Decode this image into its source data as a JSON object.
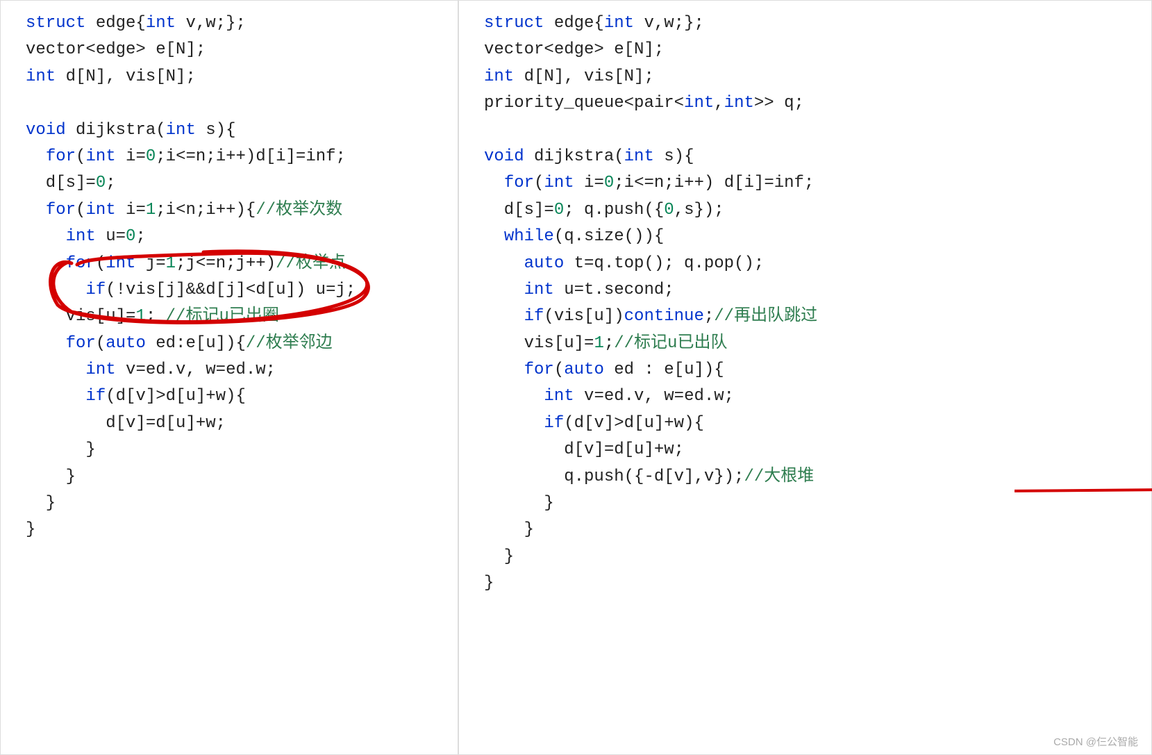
{
  "watermark": "CSDN @仨公智能",
  "left": {
    "tokens": [
      [
        [
          "kw",
          "struct"
        ],
        [
          "txt",
          " edge{"
        ],
        [
          "kw",
          "int"
        ],
        [
          "txt",
          " v,w;};"
        ]
      ],
      [
        [
          "txt",
          "vector<edge> e[N];"
        ]
      ],
      [
        [
          "kw",
          "int"
        ],
        [
          "txt",
          " d[N], vis[N];"
        ]
      ],
      [
        [
          "txt",
          ""
        ]
      ],
      [
        [
          "kw",
          "void"
        ],
        [
          "txt",
          " dijkstra("
        ],
        [
          "kw",
          "int"
        ],
        [
          "txt",
          " s){"
        ]
      ],
      [
        [
          "txt",
          "  "
        ],
        [
          "kw",
          "for"
        ],
        [
          "txt",
          "("
        ],
        [
          "kw",
          "int"
        ],
        [
          "txt",
          " i="
        ],
        [
          "num",
          "0"
        ],
        [
          "txt",
          ";i<=n;i++)d[i]=inf;"
        ]
      ],
      [
        [
          "txt",
          "  d[s]="
        ],
        [
          "num",
          "0"
        ],
        [
          "txt",
          ";"
        ]
      ],
      [
        [
          "txt",
          "  "
        ],
        [
          "kw",
          "for"
        ],
        [
          "txt",
          "("
        ],
        [
          "kw",
          "int"
        ],
        [
          "txt",
          " i="
        ],
        [
          "num",
          "1"
        ],
        [
          "txt",
          ";i<n;i++){"
        ],
        [
          "cm",
          "//枚举次数"
        ]
      ],
      [
        [
          "txt",
          "    "
        ],
        [
          "kw",
          "int"
        ],
        [
          "txt",
          " u="
        ],
        [
          "num",
          "0"
        ],
        [
          "txt",
          ";"
        ]
      ],
      [
        [
          "txt",
          "    "
        ],
        [
          "kw",
          "for"
        ],
        [
          "txt",
          "("
        ],
        [
          "kw",
          "int"
        ],
        [
          "txt",
          " j="
        ],
        [
          "num",
          "1"
        ],
        [
          "txt",
          ";j<=n;j++)"
        ],
        [
          "cm",
          "//枚举点"
        ]
      ],
      [
        [
          "txt",
          "      "
        ],
        [
          "kw",
          "if"
        ],
        [
          "txt",
          "(!vis[j]&&d[j]<d[u]) u=j;"
        ]
      ],
      [
        [
          "txt",
          "    vis[u]="
        ],
        [
          "num",
          "1"
        ],
        [
          "txt",
          "; "
        ],
        [
          "cm",
          "//标记u已出圈"
        ]
      ],
      [
        [
          "txt",
          "    "
        ],
        [
          "kw",
          "for"
        ],
        [
          "txt",
          "("
        ],
        [
          "kw",
          "auto"
        ],
        [
          "txt",
          " ed:e[u]){"
        ],
        [
          "cm",
          "//枚举邻边"
        ]
      ],
      [
        [
          "txt",
          "      "
        ],
        [
          "kw",
          "int"
        ],
        [
          "txt",
          " v=ed.v, w=ed.w;"
        ]
      ],
      [
        [
          "txt",
          "      "
        ],
        [
          "kw",
          "if"
        ],
        [
          "txt",
          "(d[v]>d[u]+w){"
        ]
      ],
      [
        [
          "txt",
          "        d[v]=d[u]+w;"
        ]
      ],
      [
        [
          "txt",
          "      }"
        ]
      ],
      [
        [
          "txt",
          "    }"
        ]
      ],
      [
        [
          "txt",
          "  }"
        ]
      ],
      [
        [
          "txt",
          "}"
        ]
      ]
    ]
  },
  "right": {
    "tokens": [
      [
        [
          "kw",
          "struct"
        ],
        [
          "txt",
          " edge{"
        ],
        [
          "kw",
          "int"
        ],
        [
          "txt",
          " v,w;};"
        ]
      ],
      [
        [
          "txt",
          "vector<edge> e[N];"
        ]
      ],
      [
        [
          "kw",
          "int"
        ],
        [
          "txt",
          " d[N], vis[N];"
        ]
      ],
      [
        [
          "txt",
          "priority_queue<pair<"
        ],
        [
          "kw",
          "int"
        ],
        [
          "txt",
          ","
        ],
        [
          "kw",
          "int"
        ],
        [
          "txt",
          ">> q;"
        ]
      ],
      [
        [
          "txt",
          ""
        ]
      ],
      [
        [
          "kw",
          "void"
        ],
        [
          "txt",
          " dijkstra("
        ],
        [
          "kw",
          "int"
        ],
        [
          "txt",
          " s){"
        ]
      ],
      [
        [
          "txt",
          "  "
        ],
        [
          "kw",
          "for"
        ],
        [
          "txt",
          "("
        ],
        [
          "kw",
          "int"
        ],
        [
          "txt",
          " i="
        ],
        [
          "num",
          "0"
        ],
        [
          "txt",
          ";i<=n;i++) d[i]=inf;"
        ]
      ],
      [
        [
          "txt",
          "  d[s]="
        ],
        [
          "num",
          "0"
        ],
        [
          "txt",
          "; q.push({"
        ],
        [
          "num",
          "0"
        ],
        [
          "txt",
          ",s});"
        ]
      ],
      [
        [
          "txt",
          "  "
        ],
        [
          "kw",
          "while"
        ],
        [
          "txt",
          "(q.size()){"
        ]
      ],
      [
        [
          "txt",
          "    "
        ],
        [
          "kw",
          "auto"
        ],
        [
          "txt",
          " t=q.top(); q.pop();"
        ]
      ],
      [
        [
          "txt",
          "    "
        ],
        [
          "kw",
          "int"
        ],
        [
          "txt",
          " u=t.second;"
        ]
      ],
      [
        [
          "txt",
          "    "
        ],
        [
          "kw",
          "if"
        ],
        [
          "txt",
          "(vis[u])"
        ],
        [
          "kw",
          "continue"
        ],
        [
          "txt",
          ";"
        ],
        [
          "cm",
          "//再出队跳过"
        ]
      ],
      [
        [
          "txt",
          "    vis[u]="
        ],
        [
          "num",
          "1"
        ],
        [
          "txt",
          ";"
        ],
        [
          "cm",
          "//标记u已出队"
        ]
      ],
      [
        [
          "txt",
          "    "
        ],
        [
          "kw",
          "for"
        ],
        [
          "txt",
          "("
        ],
        [
          "kw",
          "auto"
        ],
        [
          "txt",
          " ed : e[u]){"
        ]
      ],
      [
        [
          "txt",
          "      "
        ],
        [
          "kw",
          "int"
        ],
        [
          "txt",
          " v=ed.v, w=ed.w;"
        ]
      ],
      [
        [
          "txt",
          "      "
        ],
        [
          "kw",
          "if"
        ],
        [
          "txt",
          "(d[v]>d[u]+w){"
        ]
      ],
      [
        [
          "txt",
          "        d[v]=d[u]+w;"
        ]
      ],
      [
        [
          "txt",
          "        q.push({-d[v],v});"
        ],
        [
          "cm",
          "//大根堆"
        ]
      ],
      [
        [
          "txt",
          "      }"
        ]
      ],
      [
        [
          "txt",
          "    }"
        ]
      ],
      [
        [
          "txt",
          "  }"
        ]
      ],
      [
        [
          "txt",
          "}"
        ]
      ]
    ]
  }
}
